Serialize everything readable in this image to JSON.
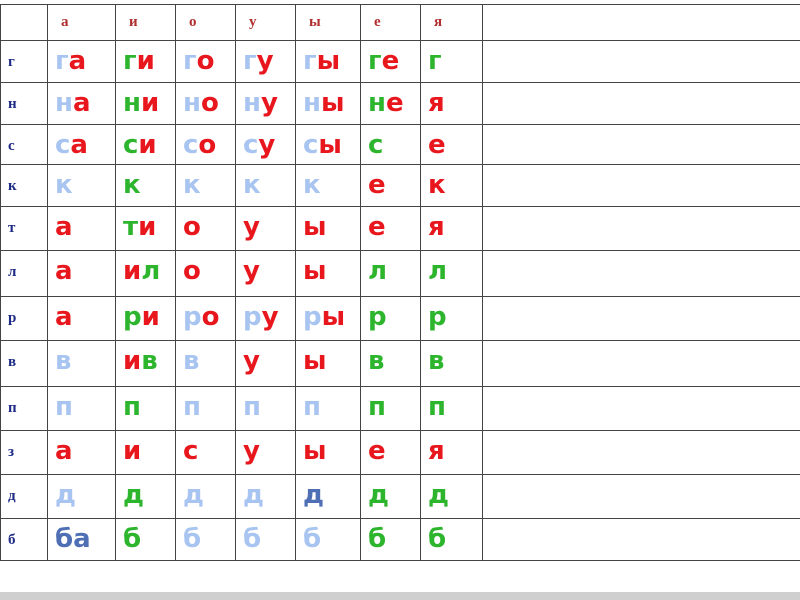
{
  "colors": {
    "header": "#b03030",
    "row_label": "#1e2b86",
    "light_blue": "#a8c4f0",
    "red": "#e8171d",
    "green": "#2db52d",
    "blue": "#4f6fb5"
  },
  "columns": [
    "а",
    "и",
    "о",
    "у",
    "ы",
    "е",
    "я"
  ],
  "rows": [
    "г",
    "н",
    "с",
    "к",
    "т",
    "л",
    "р",
    "в",
    "п",
    "з",
    "д",
    "б"
  ],
  "cells": [
    [
      {
        "c": "г",
        "cc": "light_blue",
        "v": "а",
        "vc": "red"
      },
      {
        "c": "г",
        "cc": "green",
        "v": "и",
        "vc": "red"
      },
      {
        "c": "г",
        "cc": "light_blue",
        "v": "о",
        "vc": "red"
      },
      {
        "c": "г",
        "cc": "light_blue",
        "v": "у",
        "vc": "red"
      },
      {
        "c": "г",
        "cc": "light_blue",
        "v": "ы",
        "vc": "red"
      },
      {
        "c": "г",
        "cc": "green",
        "v": "е",
        "vc": "red"
      },
      {
        "c": "г",
        "cc": "green",
        "v": "",
        "vc": "red"
      }
    ],
    [
      {
        "c": "н",
        "cc": "light_blue",
        "v": "а",
        "vc": "red"
      },
      {
        "c": "н",
        "cc": "green",
        "v": "и",
        "vc": "red"
      },
      {
        "c": "н",
        "cc": "light_blue",
        "v": "о",
        "vc": "red"
      },
      {
        "c": "н",
        "cc": "light_blue",
        "v": "у",
        "vc": "red"
      },
      {
        "c": "н",
        "cc": "light_blue",
        "v": "ы",
        "vc": "red"
      },
      {
        "c": "н",
        "cc": "green",
        "v": "е",
        "vc": "red"
      },
      {
        "c": "я",
        "cc": "red",
        "v": "",
        "vc": "red"
      }
    ],
    [
      {
        "c": "с",
        "cc": "light_blue",
        "v": "а",
        "vc": "red"
      },
      {
        "c": "с",
        "cc": "green",
        "v": "и",
        "vc": "red"
      },
      {
        "c": "с",
        "cc": "light_blue",
        "v": "о",
        "vc": "red"
      },
      {
        "c": "с",
        "cc": "light_blue",
        "v": "у",
        "vc": "red"
      },
      {
        "c": "с",
        "cc": "light_blue",
        "v": "ы",
        "vc": "red"
      },
      {
        "c": "с",
        "cc": "green",
        "v": "",
        "vc": "red"
      },
      {
        "c": "е",
        "cc": "red",
        "v": "",
        "vc": "red"
      }
    ],
    [
      {
        "c": "к",
        "cc": "light_blue",
        "v": "",
        "vc": "red"
      },
      {
        "c": "к",
        "cc": "green",
        "v": "",
        "vc": "red"
      },
      {
        "c": "к",
        "cc": "light_blue",
        "v": "",
        "vc": "red"
      },
      {
        "c": "к",
        "cc": "light_blue",
        "v": "",
        "vc": "red"
      },
      {
        "c": "к",
        "cc": "light_blue",
        "v": "",
        "vc": "red"
      },
      {
        "c": "е",
        "cc": "red",
        "v": "",
        "vc": "red"
      },
      {
        "c": "к",
        "cc": "red",
        "v": "",
        "vc": "red"
      }
    ],
    [
      {
        "c": "а",
        "cc": "red",
        "v": "",
        "vc": "red"
      },
      {
        "c": "т",
        "cc": "green",
        "v": "и",
        "vc": "red"
      },
      {
        "c": "о",
        "cc": "red",
        "v": "",
        "vc": "red"
      },
      {
        "c": "у",
        "cc": "red",
        "v": "",
        "vc": "red"
      },
      {
        "c": "ы",
        "cc": "red",
        "v": "",
        "vc": "red"
      },
      {
        "c": "е",
        "cc": "red",
        "v": "",
        "vc": "red"
      },
      {
        "c": "я",
        "cc": "red",
        "v": "",
        "vc": "red"
      }
    ],
    [
      {
        "c": "а",
        "cc": "red",
        "v": "",
        "vc": "red"
      },
      {
        "c": "и",
        "cc": "red",
        "v": "л",
        "vc": "green"
      },
      {
        "c": "о",
        "cc": "red",
        "v": "",
        "vc": "red"
      },
      {
        "c": "у",
        "cc": "red",
        "v": "",
        "vc": "red"
      },
      {
        "c": "ы",
        "cc": "red",
        "v": "",
        "vc": "red"
      },
      {
        "c": "л",
        "cc": "green",
        "v": "",
        "vc": "red"
      },
      {
        "c": "л",
        "cc": "green",
        "v": "",
        "vc": "red"
      }
    ],
    [
      {
        "c": "а",
        "cc": "red",
        "v": "",
        "vc": "red"
      },
      {
        "c": "р",
        "cc": "green",
        "v": "и",
        "vc": "red"
      },
      {
        "c": "р",
        "cc": "light_blue",
        "v": "о",
        "vc": "red"
      },
      {
        "c": "р",
        "cc": "light_blue",
        "v": "у",
        "vc": "red"
      },
      {
        "c": "р",
        "cc": "light_blue",
        "v": "ы",
        "vc": "red"
      },
      {
        "c": "р",
        "cc": "green",
        "v": "",
        "vc": "red"
      },
      {
        "c": "р",
        "cc": "green",
        "v": "",
        "vc": "red"
      }
    ],
    [
      {
        "c": "в",
        "cc": "light_blue",
        "v": "",
        "vc": "red"
      },
      {
        "c": "и",
        "cc": "red",
        "v": "в",
        "vc": "green"
      },
      {
        "c": "в",
        "cc": "light_blue",
        "v": "",
        "vc": "red"
      },
      {
        "c": "у",
        "cc": "red",
        "v": "",
        "vc": "red"
      },
      {
        "c": "ы",
        "cc": "red",
        "v": "",
        "vc": "red"
      },
      {
        "c": "в",
        "cc": "green",
        "v": "",
        "vc": "red"
      },
      {
        "c": "в",
        "cc": "green",
        "v": "",
        "vc": "red"
      }
    ],
    [
      {
        "c": "п",
        "cc": "light_blue",
        "v": "",
        "vc": "red"
      },
      {
        "c": "п",
        "cc": "green",
        "v": "",
        "vc": "red"
      },
      {
        "c": "п",
        "cc": "light_blue",
        "v": "",
        "vc": "red"
      },
      {
        "c": "п",
        "cc": "light_blue",
        "v": "",
        "vc": "red"
      },
      {
        "c": "п",
        "cc": "light_blue",
        "v": "",
        "vc": "red"
      },
      {
        "c": "п",
        "cc": "green",
        "v": "",
        "vc": "red"
      },
      {
        "c": "п",
        "cc": "green",
        "v": "",
        "vc": "red"
      }
    ],
    [
      {
        "c": "а",
        "cc": "red",
        "v": "",
        "vc": "red"
      },
      {
        "c": "и",
        "cc": "red",
        "v": "",
        "vc": "red"
      },
      {
        "c": "с",
        "cc": "red",
        "v": "",
        "vc": "red"
      },
      {
        "c": "у",
        "cc": "red",
        "v": "",
        "vc": "red"
      },
      {
        "c": "ы",
        "cc": "red",
        "v": "",
        "vc": "red"
      },
      {
        "c": "е",
        "cc": "red",
        "v": "",
        "vc": "red"
      },
      {
        "c": "я",
        "cc": "red",
        "v": "",
        "vc": "red"
      }
    ],
    [
      {
        "c": "д",
        "cc": "light_blue",
        "v": "",
        "vc": "red"
      },
      {
        "c": "д",
        "cc": "green",
        "v": "",
        "vc": "red"
      },
      {
        "c": "д",
        "cc": "light_blue",
        "v": "",
        "vc": "red"
      },
      {
        "c": "д",
        "cc": "light_blue",
        "v": "",
        "vc": "red"
      },
      {
        "c": "д",
        "cc": "blue",
        "v": "",
        "vc": "red"
      },
      {
        "c": "д",
        "cc": "green",
        "v": "",
        "vc": "red"
      },
      {
        "c": "д",
        "cc": "green",
        "v": "",
        "vc": "red"
      }
    ],
    [
      {
        "c": "ба",
        "cc": "blue",
        "v": "",
        "vc": "red"
      },
      {
        "c": "б",
        "cc": "green",
        "v": "",
        "vc": "red"
      },
      {
        "c": "б",
        "cc": "light_blue",
        "v": "",
        "vc": "red"
      },
      {
        "c": "б",
        "cc": "light_blue",
        "v": "",
        "vc": "red"
      },
      {
        "c": "б",
        "cc": "light_blue",
        "v": "",
        "vc": "red"
      },
      {
        "c": "б",
        "cc": "green",
        "v": "",
        "vc": "red"
      },
      {
        "c": "б",
        "cc": "green",
        "v": "",
        "vc": "red"
      }
    ]
  ]
}
